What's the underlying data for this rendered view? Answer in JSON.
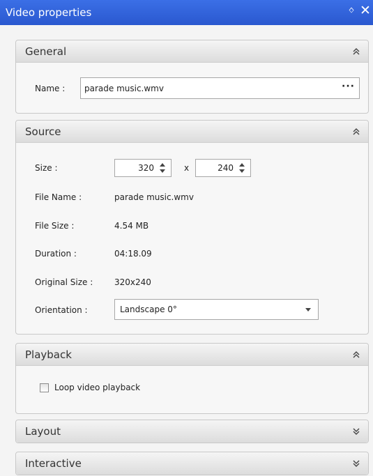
{
  "window": {
    "title": "Video properties",
    "pin_icon": "pin-icon",
    "close_icon": "close-icon",
    "pin_glyph": "ᛜ",
    "close_glyph": "✕"
  },
  "sections": {
    "general": {
      "title": "General",
      "state": "expanded",
      "name_label": "Name :",
      "name_value": "parade music.wmv",
      "browse_label": "···"
    },
    "source": {
      "title": "Source",
      "state": "expanded",
      "size_label": "Size :",
      "width_value": "320",
      "x_label": "x",
      "height_value": "240",
      "file_name_label": "File Name :",
      "file_name_value": "parade music.wmv",
      "file_size_label": "File Size :",
      "file_size_value": "4.54 MB",
      "duration_label": "Duration :",
      "duration_value": "04:18.09",
      "original_size_label": "Original Size :",
      "original_size_value": "320x240",
      "orientation_label": "Orientation :",
      "orientation_value": "Landscape 0°"
    },
    "playback": {
      "title": "Playback",
      "state": "expanded",
      "loop_label": "Loop video playback",
      "loop_checked": false
    },
    "layout": {
      "title": "Layout",
      "state": "collapsed"
    },
    "interactive": {
      "title": "Interactive",
      "state": "collapsed"
    }
  },
  "colors": {
    "titlebar": "#2f5fd8",
    "panel_background": "#f4f4f4"
  }
}
